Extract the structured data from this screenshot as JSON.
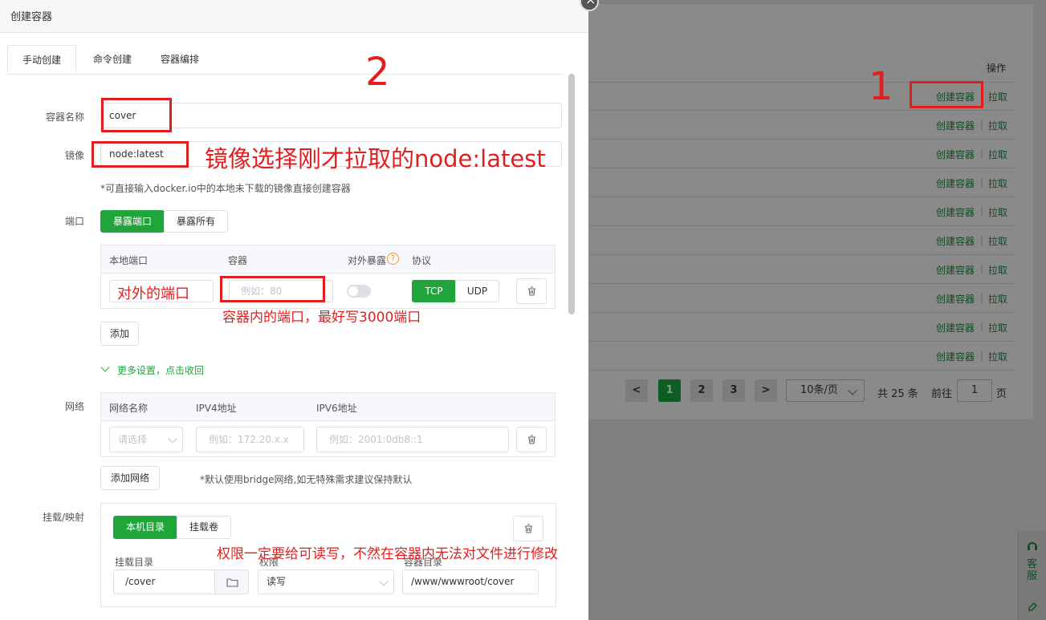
{
  "background": {
    "header_ops": "操作",
    "rows": [
      {
        "create": "创建容器",
        "pull": "拉取"
      },
      {
        "create": "创建容器",
        "pull": "拉取"
      },
      {
        "create": "创建容器",
        "pull": "拉取"
      },
      {
        "create": "创建容器",
        "pull": "拉取"
      },
      {
        "create": "创建容器",
        "pull": "拉取"
      },
      {
        "create": "创建容器",
        "pull": "拉取"
      },
      {
        "create": "创建容器",
        "pull": "拉取"
      },
      {
        "create": "创建容器",
        "pull": "拉取"
      },
      {
        "create": "创建容器",
        "pull": "拉取"
      },
      {
        "create": "创建容器",
        "pull": "拉取"
      }
    ],
    "row_sep": "|",
    "pager": {
      "prev": "<",
      "pages": [
        "1",
        "2",
        "3"
      ],
      "next": ">",
      "page_size": "10条/页",
      "total": "共 25 条",
      "goto": "前往",
      "page_value": "1",
      "page_unit": "页"
    },
    "side_widget": {
      "label": "客服"
    }
  },
  "modal": {
    "title": "创建容器",
    "tabs": [
      "手动创建",
      "命令创建",
      "容器编排"
    ],
    "name": {
      "label": "容器名称",
      "value": "cover"
    },
    "image": {
      "label": "镜像",
      "value": "node:latest",
      "hint": "*可直接输入docker.io中的本地未下载的镜像直接创建容器"
    },
    "port": {
      "label": "端口",
      "modes": [
        "暴露端口",
        "暴露所有"
      ],
      "cols": [
        "本地端口",
        "容器",
        "对外暴露",
        "协议"
      ],
      "container_placeholder": "例如：80",
      "protocols": [
        "TCP",
        "UDP"
      ],
      "add": "添加"
    },
    "more": "更多设置，点击收回",
    "network": {
      "label": "网络",
      "cols": [
        "网络名称",
        "IPV4地址",
        "IPV6地址"
      ],
      "select_placeholder": "请选择",
      "ipv4_placeholder": "例如：172.20.x.x",
      "ipv6_placeholder": "例如：2001:0db8::1",
      "add": "添加网络",
      "hint": "*默认使用bridge网络,如无特殊需求建议保持默认"
    },
    "mount": {
      "label": "挂载/映射",
      "modes": [
        "本机目录",
        "挂载卷"
      ],
      "cols": [
        "挂载目录",
        "权限",
        "容器目录"
      ],
      "host_dir": "/cover",
      "permission": "读写",
      "container_dir": "/www/wwwroot/cover"
    }
  },
  "annotations": {
    "step1": "1",
    "step2": "2",
    "image_note": "镜像选择刚才拉取的node:latest",
    "local_port_note": "对外的端口",
    "container_port_note": "容器内的端口，最好写3000端口",
    "permission_note": "权限一定要给可读写，不然在容器内无法对文件进行修改"
  }
}
